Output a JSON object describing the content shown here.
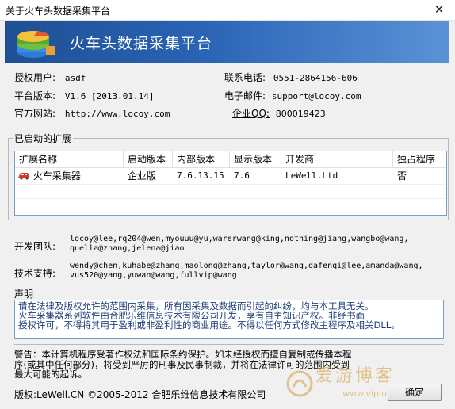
{
  "window": {
    "title": "关于火车头数据采集平台",
    "close_glyph": "✕"
  },
  "banner": {
    "app_title": "火车头数据采集平台"
  },
  "info": {
    "licensee_label": "授权用户:",
    "licensee_value": "asdf",
    "version_label": "平台版本:",
    "version_value": "V1.6 [2013.01.14]",
    "website_label": "官方网站:",
    "website_value": "http://www.locoy.com",
    "phone_label": "联系电话:",
    "phone_value": "0551-2864156-606",
    "email_label": "电子邮件:",
    "email_value": "support@locoy.com",
    "qq_label": "企业QQ:",
    "qq_value": "800019423"
  },
  "extensions": {
    "section_label": "已启动的扩展",
    "columns": [
      "扩展名称",
      "启动版本",
      "内部版本",
      "显示版本",
      "开发商",
      "独占程序"
    ],
    "rows": [
      {
        "name": "火车采集器",
        "edition": "企业版",
        "internal": "7.6.13.15",
        "display": "7.6",
        "vendor": "LeWell.Ltd",
        "exclusive": "否"
      }
    ]
  },
  "team": {
    "label": "开发团队:",
    "line1": "locoy@lee,rq204@wen,myouuu@yu,warerwang@king,nothing@jiang,wangbo@wang,",
    "line2": "quella@zhang,jelena@jiao"
  },
  "support": {
    "label": "技术支持:",
    "line1": "wendy@chen,kuhabe@zhang,maolong@zhang,taylor@wang,dafenqi@lee,amanda@wang,",
    "line2": "vus520@yang,yuwan@wang,fullvip@wang"
  },
  "statement": {
    "label": "声明",
    "line1": "请在法律及版权允许的范围内采集，所有因采集及数据而引起的纠纷，均与本工具无关。",
    "line2": "火车采集器系列软件由合肥乐维信息技术有限公司开发，享有自主知识产权。非经书面",
    "line3": "授权许可，不得将其用于盈利或非盈利性的商业用途。不得以任何方式修改主程序及相关DLL。"
  },
  "warning": {
    "line1": "警告：本计算机程序受著作权法和国际条约保护。如未经授权而擅自复制或传播本程",
    "line2": "序(或其中任何部分)，将受到严厉的刑事及民事制裁，并将在法律许可的范围内受到",
    "line3": "最大可能的起诉。"
  },
  "copyright": "版权:LeWell.CN ©2005-2012 合肥乐维信息技术有限公司",
  "ok_button": "确定",
  "watermark": {
    "text1": "爱游博客",
    "text2": "www.vipiu.net"
  }
}
